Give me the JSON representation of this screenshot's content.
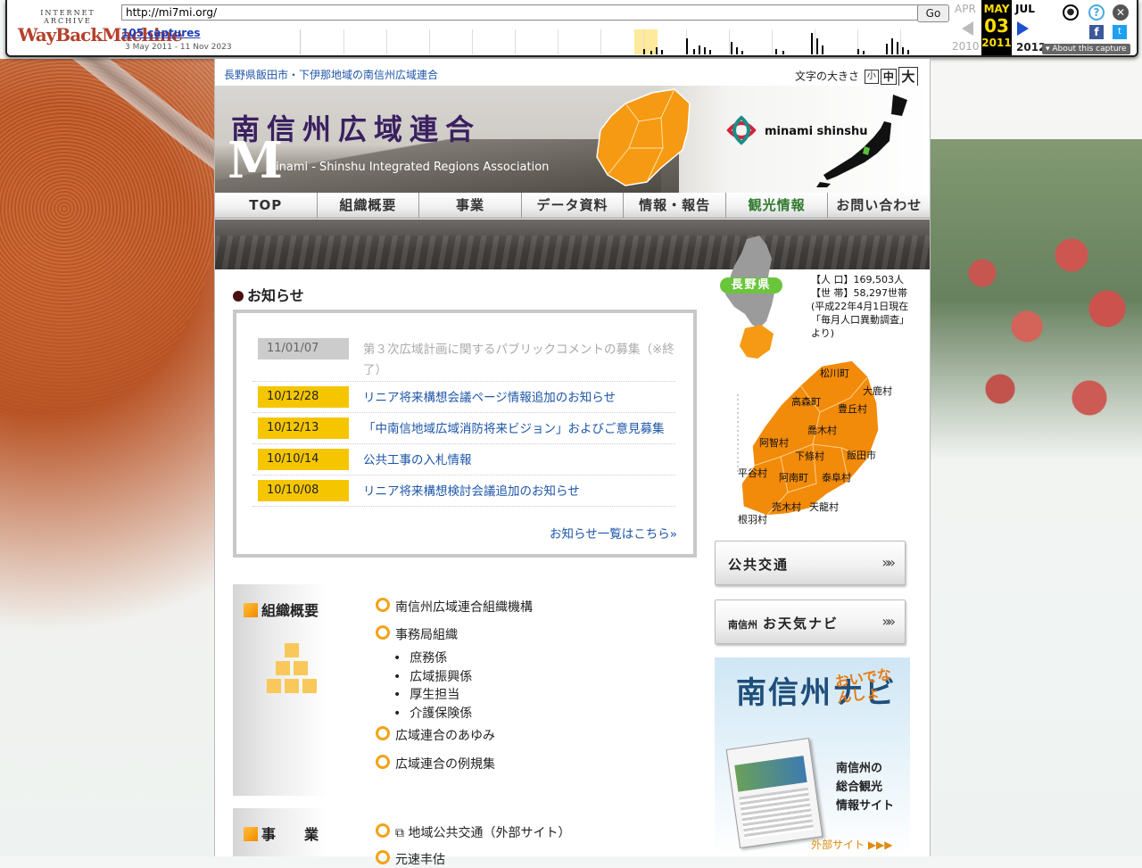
{
  "wayback": {
    "logo_top": "INTERNET ARCHIVE",
    "logo_main": "WayBackMachine",
    "url": "http://mi7mi.org/",
    "go": "Go",
    "captures": "105 captures",
    "range": "3 May 2011 - 11 Nov 2023",
    "prev_month": "APR",
    "cur_month": "MAY",
    "cur_day": "03",
    "cur_year": "2011",
    "next_month": "JUL",
    "prev_year": "2010",
    "next_year": "2012",
    "about": "About this capture"
  },
  "site": {
    "tagline": "長野県飯田市・下伊那地域の南信州広域連合",
    "font_size_label": "文字の大きさ",
    "font_small": "小",
    "font_medium": "中",
    "font_large": "大",
    "title_jp": "南信州広域連合",
    "title_big_m": "M",
    "title_en": "inami - Shinshu Integrated Regions Association",
    "logo_text": "minami shinshu"
  },
  "nav": [
    "TOP",
    "組織概要",
    "事業",
    "データ資料",
    "情報・報告",
    "観光情報",
    "お問い合わせ"
  ],
  "news": {
    "title": "お知らせ",
    "items": [
      {
        "date": "11/01/07",
        "text": "第３次広域計画に関するパブリックコメントの募集（※終了）",
        "old": true
      },
      {
        "date": "10/12/28",
        "text": "リニア将来構想会議ページ情報追加のお知らせ",
        "old": false
      },
      {
        "date": "10/12/13",
        "text": "「中南信地域広域消防将来ビジョン」およびご意見募集",
        "old": false
      },
      {
        "date": "10/10/14",
        "text": "公共工事の入札情報",
        "old": false
      },
      {
        "date": "10/10/08",
        "text": "リニア将来構想検討会議追加のお知らせ",
        "old": false
      }
    ],
    "more": "お知らせ一覧はこちら»"
  },
  "org": {
    "title": "組織概要",
    "links": [
      "南信州広域連合組織機構",
      "事務局組織",
      "広域連合のあゆみ",
      "広域連合の例規集"
    ],
    "sub": [
      "庶務係",
      "広域振興係",
      "厚生担当",
      "介護保険係"
    ]
  },
  "jigyo": {
    "title": "事　　業",
    "links": [
      "地域公共交通（外部サイト）",
      "元速丰估"
    ]
  },
  "region": {
    "badge": "長野県",
    "population": "【人 口】169,503人",
    "households": "【世 帯】58,297世帯",
    "note": "(平成22年4月1日現在「毎月人口異動調査」より)",
    "munis": [
      "松川町",
      "大鹿村",
      "高森町",
      "豊丘村",
      "喬木村",
      "阿智村",
      "下條村",
      "飯田市",
      "平谷村",
      "阿南町",
      "泰阜村",
      "売木村",
      "天龍村",
      "根羽村"
    ]
  },
  "right_buttons": {
    "transit": "公共交通",
    "weather_small": "南信州",
    "weather": "お天気ナビ",
    "arrows": "»»"
  },
  "navi": {
    "title": "南信州ナビ",
    "slogan": "おいでなんしょ",
    "desc1": "南信州の",
    "desc2": "総合観光",
    "desc3": "情報サイト",
    "ext": "外部サイト ▶▶▶"
  },
  "colors": {
    "accent_orange": "#f5c600",
    "link_blue": "#1d56a8",
    "map_orange": "#f28a0a",
    "nav_kanko": "#2f7a2f"
  }
}
